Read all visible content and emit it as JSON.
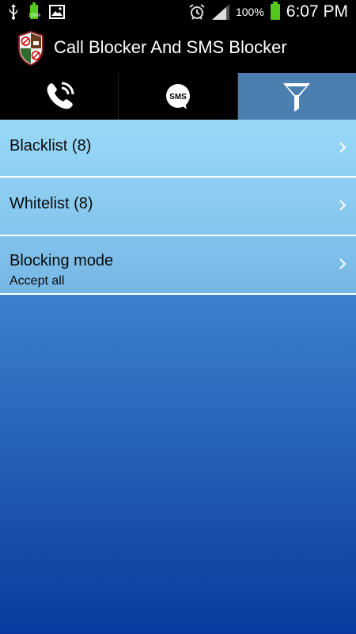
{
  "status_bar": {
    "battery_percent": "100%",
    "time": "6:07 PM",
    "small_battery_label": "100%",
    "icons": [
      "usb-icon",
      "battery-icon",
      "image-icon",
      "alarm-icon",
      "signal-icon",
      "battery-icon"
    ]
  },
  "action_bar": {
    "title": "Call Blocker And SMS Blocker",
    "logo_icon": "shield-logo-icon"
  },
  "tabs": [
    {
      "name": "calls",
      "icon": "phone-ringing-icon",
      "active": false
    },
    {
      "name": "sms",
      "icon": "sms-bubble-icon",
      "label": "SMS",
      "active": false
    },
    {
      "name": "filter",
      "icon": "filter-funnel-icon",
      "active": true
    }
  ],
  "list": {
    "items": [
      {
        "title": "Blacklist (8)",
        "subtitle": ""
      },
      {
        "title": "Whitelist (8)",
        "subtitle": ""
      },
      {
        "title": "Blocking mode",
        "subtitle": "Accept all"
      }
    ]
  },
  "colors": {
    "active_tab": "#4a7fb0",
    "background_top": "#7fcaf0",
    "background_bottom": "#0a3a9e",
    "battery": "#55c81e"
  }
}
